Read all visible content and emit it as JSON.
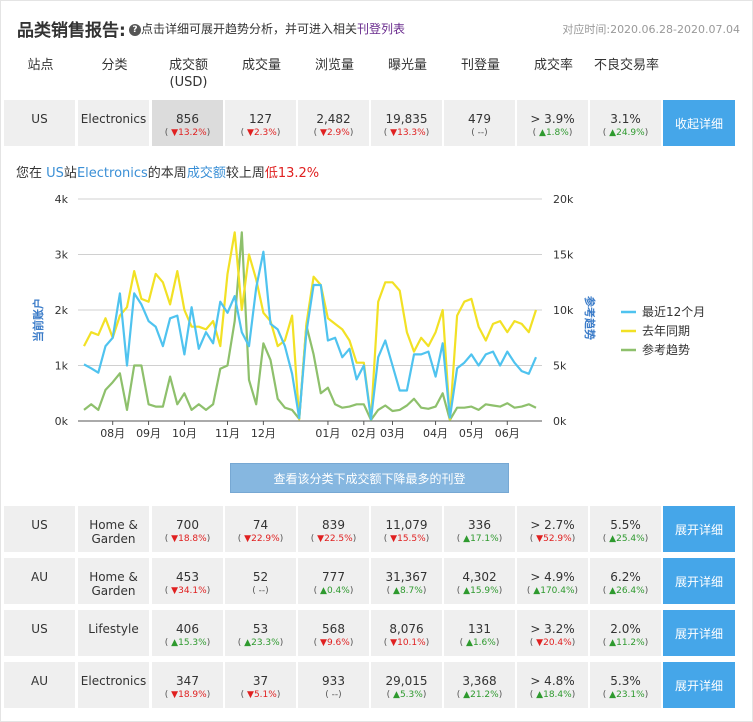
{
  "header": {
    "title": "品类销售报告:",
    "hint_text": "点击详细可展开趋势分析，并可进入相关",
    "hint_link": "刊登列表",
    "period": "对应时间:2020.06.28-2020.07.04"
  },
  "columns": [
    "站点",
    "分类",
    "成交额\n(USD)",
    "成交量",
    "浏览量",
    "曝光量",
    "刊登量",
    "成交率",
    "不良交易率"
  ],
  "selected_row": {
    "site": "US",
    "category": "Electronics",
    "cells": [
      {
        "value": "856",
        "pct": "13.2%",
        "dir": "down"
      },
      {
        "value": "127",
        "pct": "2.3%",
        "dir": "down"
      },
      {
        "value": "2,482",
        "pct": "2.9%",
        "dir": "down"
      },
      {
        "value": "19,835",
        "pct": "13.3%",
        "dir": "down"
      },
      {
        "value": "479",
        "pct": "--",
        "dir": "none"
      },
      {
        "value": "> 3.9%",
        "pct": "1.8%",
        "dir": "up"
      },
      {
        "value": "3.1%",
        "pct": "24.9%",
        "dir": "up"
      }
    ],
    "button": "收起详细"
  },
  "summary": {
    "p1": "您在 ",
    "site": "US",
    "p2": "站",
    "category": "Electronics",
    "p3": "的本周",
    "metric": "成交额",
    "p4": "较上周",
    "trend": "低13.2%"
  },
  "chart_data": {
    "type": "line",
    "x_ticks": [
      "08月",
      "09月",
      "10月",
      "11月",
      "12月",
      "01月",
      "02月",
      "03月",
      "04月",
      "05月",
      "06月"
    ],
    "x_tick_pos": [
      4,
      9,
      14,
      20,
      25,
      34,
      39,
      43,
      49,
      54,
      59
    ],
    "n_points": 64,
    "y_left": {
      "label": "当前账户",
      "ticks": [
        "0k",
        "1k",
        "2k",
        "3k",
        "4k"
      ],
      "max": 4000
    },
    "y_right": {
      "label": "参考趋势",
      "ticks": [
        "0k",
        "5k",
        "10k",
        "15k",
        "20k"
      ],
      "max": 20000
    },
    "series": [
      {
        "name": "最近12个月",
        "color": "#4fc3ef",
        "axis": "left",
        "values": [
          1020,
          950,
          870,
          1350,
          1500,
          2300,
          1000,
          2300,
          2100,
          1800,
          1700,
          1350,
          1850,
          1900,
          1200,
          2050,
          1300,
          1600,
          1400,
          2150,
          1950,
          2250,
          1600,
          1350,
          2400,
          3050,
          1750,
          1650,
          1350,
          850,
          50,
          1600,
          2450,
          2450,
          1450,
          1500,
          1150,
          1300,
          750,
          1000,
          30,
          1150,
          1450,
          1000,
          550,
          550,
          1200,
          1200,
          1250,
          800,
          1400,
          60,
          950,
          1050,
          1200,
          1000,
          1200,
          1250,
          1000,
          1250,
          1050,
          900,
          850,
          1150
        ]
      },
      {
        "name": "去年同期",
        "color": "#f2e125",
        "axis": "left",
        "values": [
          1350,
          1600,
          1550,
          1850,
          1500,
          1900,
          2050,
          2700,
          2200,
          2150,
          2650,
          2500,
          2100,
          2700,
          2000,
          1700,
          1700,
          1650,
          1800,
          1350,
          2650,
          3400,
          2000,
          3000,
          2550,
          1950,
          1800,
          1350,
          1450,
          1900,
          30,
          1750,
          2600,
          2450,
          1850,
          1750,
          1650,
          1450,
          1050,
          1050,
          50,
          2150,
          2500,
          2500,
          2350,
          1600,
          1250,
          1500,
          1350,
          1600,
          2000,
          30,
          1900,
          2150,
          2200,
          1700,
          1450,
          1750,
          1800,
          1600,
          1800,
          1750,
          1600,
          2000
        ]
      },
      {
        "name": "参考趋势",
        "color": "#8ec06c",
        "axis": "right",
        "values": [
          1000,
          1500,
          1000,
          2800,
          3500,
          4300,
          1000,
          5000,
          5000,
          1500,
          1300,
          1300,
          4000,
          1500,
          2500,
          1000,
          1500,
          1000,
          1500,
          4700,
          5000,
          9000,
          17000,
          3700,
          1500,
          7000,
          5500,
          2000,
          1200,
          1000,
          200,
          8600,
          6000,
          2500,
          3000,
          1500,
          1200,
          1300,
          1500,
          1500,
          100,
          1000,
          1400,
          900,
          1000,
          1400,
          2000,
          1200,
          1100,
          1300,
          2500,
          100,
          1200,
          1200,
          1300,
          1000,
          1500,
          1400,
          1300,
          1600,
          1200,
          1300,
          1500,
          1200
        ]
      }
    ],
    "legend": "right"
  },
  "action_button": "查看该分类下成交额下降最多的刊登",
  "rows": [
    {
      "site": "US",
      "category": "Home &\nGarden",
      "button": "展开详细",
      "cells": [
        {
          "value": "700",
          "pct": "18.8%",
          "dir": "down"
        },
        {
          "value": "74",
          "pct": "22.9%",
          "dir": "down"
        },
        {
          "value": "839",
          "pct": "22.5%",
          "dir": "down"
        },
        {
          "value": "11,079",
          "pct": "15.5%",
          "dir": "down"
        },
        {
          "value": "336",
          "pct": "17.1%",
          "dir": "up"
        },
        {
          "value": "> 2.7%",
          "pct": "52.9%",
          "dir": "down"
        },
        {
          "value": "5.5%",
          "pct": "25.4%",
          "dir": "up"
        }
      ]
    },
    {
      "site": "AU",
      "category": "Home &\nGarden",
      "button": "展开详细",
      "cells": [
        {
          "value": "453",
          "pct": "34.1%",
          "dir": "down"
        },
        {
          "value": "52",
          "pct": "--",
          "dir": "none"
        },
        {
          "value": "777",
          "pct": "0.4%",
          "dir": "up"
        },
        {
          "value": "31,367",
          "pct": "8.7%",
          "dir": "up"
        },
        {
          "value": "4,302",
          "pct": "15.9%",
          "dir": "up"
        },
        {
          "value": "> 4.9%",
          "pct": "170.4%",
          "dir": "up"
        },
        {
          "value": "6.2%",
          "pct": "26.4%",
          "dir": "up"
        }
      ]
    },
    {
      "site": "US",
      "category": "Lifestyle",
      "button": "展开详细",
      "cells": [
        {
          "value": "406",
          "pct": "15.3%",
          "dir": "up"
        },
        {
          "value": "53",
          "pct": "23.3%",
          "dir": "up"
        },
        {
          "value": "568",
          "pct": "9.6%",
          "dir": "down"
        },
        {
          "value": "8,076",
          "pct": "10.1%",
          "dir": "down"
        },
        {
          "value": "131",
          "pct": "1.6%",
          "dir": "up"
        },
        {
          "value": "> 3.2%",
          "pct": "20.4%",
          "dir": "down"
        },
        {
          "value": "2.0%",
          "pct": "11.2%",
          "dir": "up"
        }
      ]
    },
    {
      "site": "AU",
      "category": "Electronics",
      "button": "展开详细",
      "cells": [
        {
          "value": "347",
          "pct": "18.9%",
          "dir": "down"
        },
        {
          "value": "37",
          "pct": "5.1%",
          "dir": "down"
        },
        {
          "value": "933",
          "pct": "--",
          "dir": "none"
        },
        {
          "value": "29,015",
          "pct": "5.3%",
          "dir": "up"
        },
        {
          "value": "3,368",
          "pct": "21.2%",
          "dir": "up"
        },
        {
          "value": "> 4.8%",
          "pct": "18.4%",
          "dir": "up"
        },
        {
          "value": "5.3%",
          "pct": "23.1%",
          "dir": "up"
        }
      ]
    }
  ]
}
